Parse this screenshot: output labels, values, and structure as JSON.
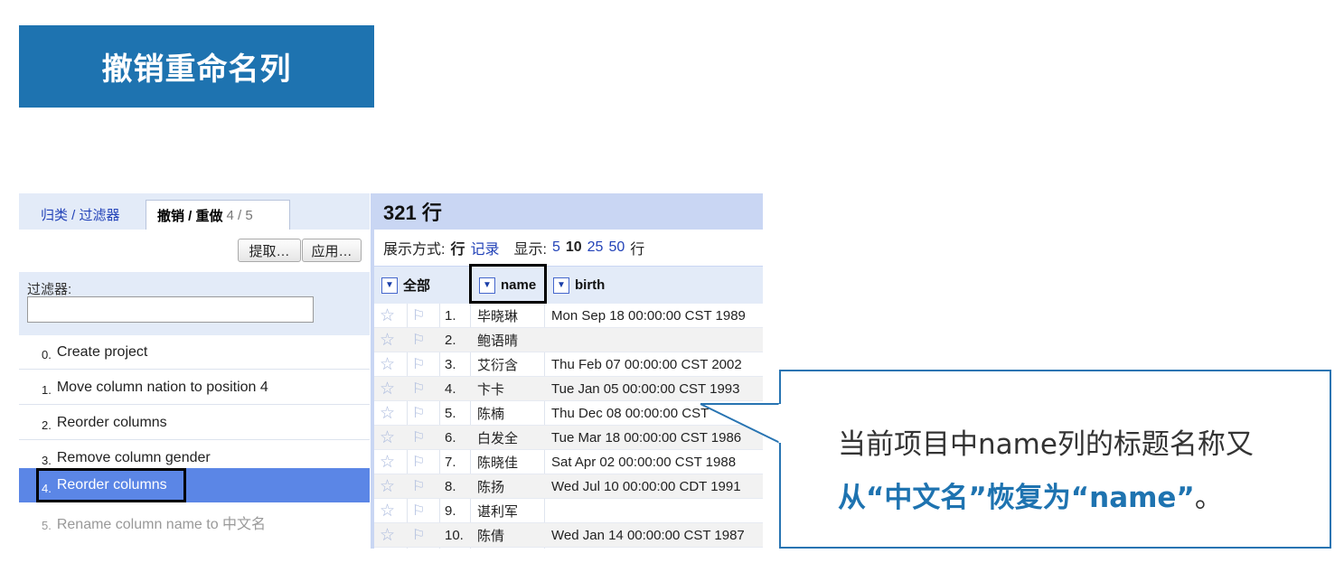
{
  "slide_title": "撤销重命名列",
  "left_panel": {
    "tab_facet": "归类 / 过滤器",
    "tab_undo": "撤销 / 重做",
    "tab_undo_count": "4 / 5",
    "extract_button": "提取…",
    "apply_button": "应用…",
    "filter_label": "过滤器:",
    "filter_value": "",
    "history": [
      {
        "num": "0.",
        "label": "Create project"
      },
      {
        "num": "1.",
        "label": "Move column nation to position 4"
      },
      {
        "num": "2.",
        "label": "Reorder columns"
      },
      {
        "num": "3.",
        "label": "Remove column gender"
      },
      {
        "num": "4.",
        "label": "Reorder columns"
      },
      {
        "num": "5.",
        "label": "Rename column name to 中文名"
      }
    ],
    "selected_index": 4
  },
  "data_panel": {
    "row_count": "321 行",
    "view_label": "展示方式:",
    "view_rows": "行",
    "view_records": "记录",
    "show_label": "显示:",
    "page_sizes": [
      "5",
      "10",
      "25",
      "50"
    ],
    "page_size_active": "10",
    "page_size_suffix": "行",
    "columns": {
      "all": "全部",
      "name": "name",
      "birth": "birth"
    },
    "rows": [
      {
        "idx": "1.",
        "name": "毕晓琳",
        "birth": "Mon Sep 18 00:00:00 CST 1989"
      },
      {
        "idx": "2.",
        "name": "鲍语晴",
        "birth": ""
      },
      {
        "idx": "3.",
        "name": "艾衍含",
        "birth": "Thu Feb 07 00:00:00 CST 2002"
      },
      {
        "idx": "4.",
        "name": "卞卡",
        "birth": "Tue Jan 05 00:00:00 CST 1993"
      },
      {
        "idx": "5.",
        "name": "陈楠",
        "birth": "Thu Dec 08 00:00:00 CST"
      },
      {
        "idx": "6.",
        "name": "白发全",
        "birth": "Tue Mar 18 00:00:00 CST 1986"
      },
      {
        "idx": "7.",
        "name": "陈晓佳",
        "birth": "Sat Apr 02 00:00:00 CST 1988"
      },
      {
        "idx": "8.",
        "name": "陈扬",
        "birth": "Wed Jul 10 00:00:00 CDT 1991"
      },
      {
        "idx": "9.",
        "name": "谌利军",
        "birth": ""
      },
      {
        "idx": "10.",
        "name": "陈倩",
        "birth": "Wed Jan 14 00:00:00 CST 1987"
      }
    ]
  },
  "callout": {
    "line1": "当前项目中name列的标题名称又",
    "line2": "从“中文名”恢复为“name”",
    "line2_tail": "。"
  },
  "colors": {
    "accent": "#1e73b0",
    "selection": "#5b86e6",
    "header_bg": "#c9d6f3"
  },
  "icons": {
    "star": "star-icon",
    "flag": "flag-icon",
    "dropdown": "dropdown-arrow-icon"
  }
}
